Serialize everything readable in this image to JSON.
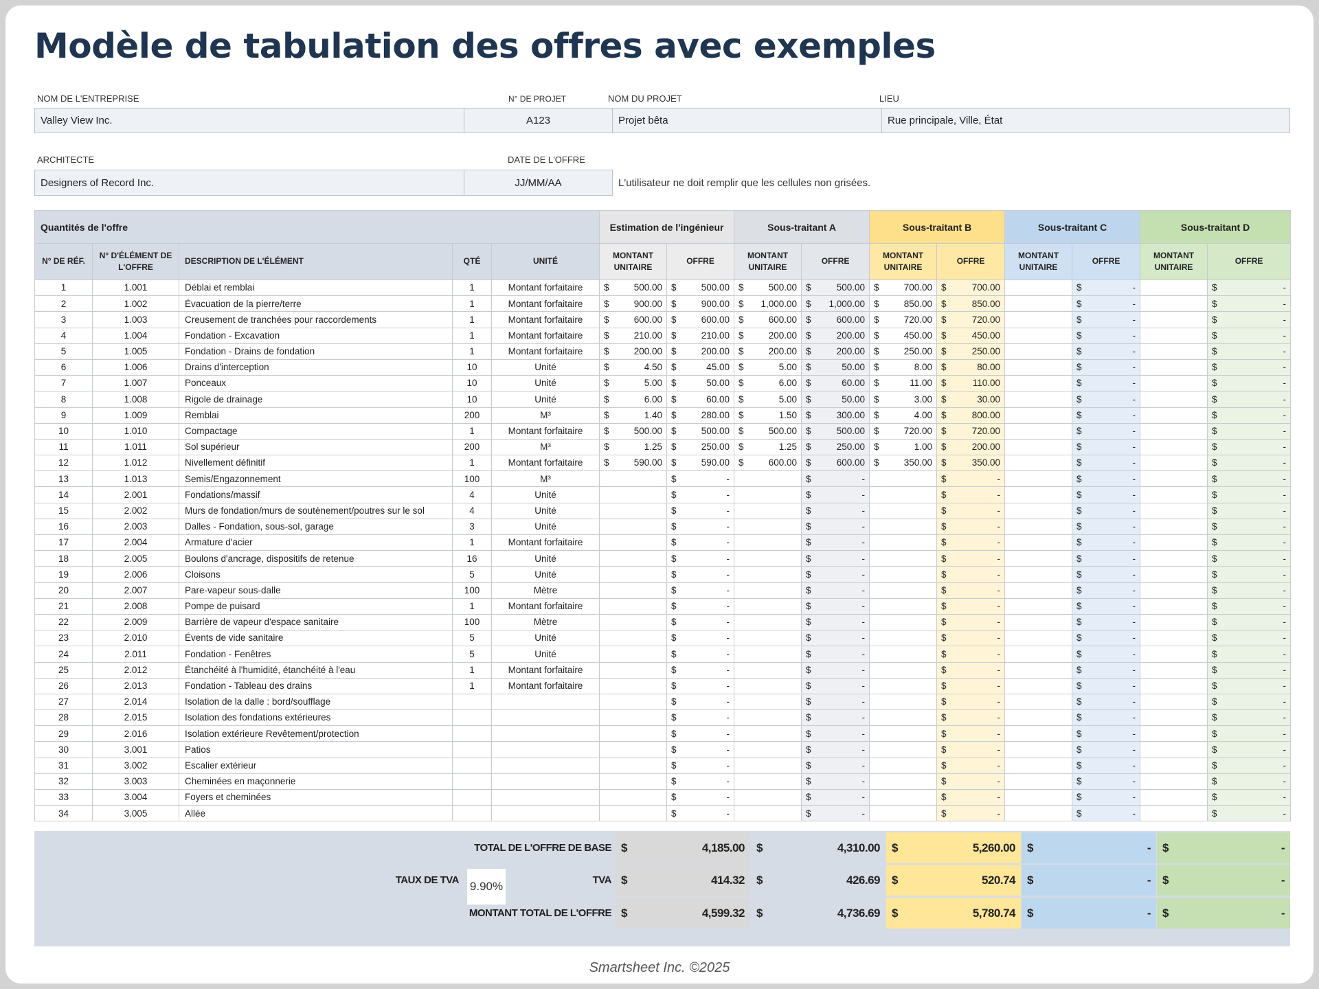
{
  "title": "Modèle de tabulation des offres avec exemples",
  "info": {
    "company_label": "NOM DE L'ENTREPRISE",
    "company_value": "Valley View Inc.",
    "project_no_label": "N° DE PROJET",
    "project_no_value": "A123",
    "project_name_label": "NOM DU PROJET",
    "project_name_value": "Projet bêta",
    "location_label": "LIEU",
    "location_value": "Rue principale, Ville, État",
    "architect_label": "ARCHITECTE",
    "architect_value": "Designers of Record Inc.",
    "date_label": "DATE DE L'OFFRE",
    "date_value": "JJ/MM/AA",
    "note": "L'utilisateur ne doit remplir que les cellules non grisées."
  },
  "table": {
    "group_header": "Quantités de l'offre",
    "vendor_headers": [
      "Estimation de l'ingénieur",
      "Sous-traitant A",
      "Sous-traitant B",
      "Sous-traitant C",
      "Sous-traitant D"
    ],
    "col_headers": {
      "ref": "N° DE RÉF.",
      "item_no": "N° D'ÉLÉMENT DE L'OFFRE",
      "desc": "DESCRIPTION DE L'ÉLÉMENT",
      "qty": "QTÉ",
      "unit": "UNITÉ",
      "unit_price": "MONTANT UNITAIRE",
      "bid": "OFFRE"
    },
    "currency": "$",
    "dash": "-",
    "rows": [
      {
        "ref": "1",
        "item": "1.001",
        "desc": "Déblai et remblai",
        "qty": "1",
        "unit": "Montant forfaitaire",
        "eu": "500.00",
        "eo": "500.00",
        "au": "500.00",
        "ao": "500.00",
        "bu": "700.00",
        "bo": "700.00"
      },
      {
        "ref": "2",
        "item": "1.002",
        "desc": "Évacuation de la pierre/terre",
        "qty": "1",
        "unit": "Montant forfaitaire",
        "eu": "900.00",
        "eo": "900.00",
        "au": "1,000.00",
        "ao": "1,000.00",
        "bu": "850.00",
        "bo": "850.00"
      },
      {
        "ref": "3",
        "item": "1.003",
        "desc": "Creusement de tranchées pour raccordements",
        "qty": "1",
        "unit": "Montant forfaitaire",
        "eu": "600.00",
        "eo": "600.00",
        "au": "600.00",
        "ao": "600.00",
        "bu": "720.00",
        "bo": "720.00"
      },
      {
        "ref": "4",
        "item": "1.004",
        "desc": "Fondation - Excavation",
        "qty": "1",
        "unit": "Montant forfaitaire",
        "eu": "210.00",
        "eo": "210.00",
        "au": "200.00",
        "ao": "200.00",
        "bu": "450.00",
        "bo": "450.00"
      },
      {
        "ref": "5",
        "item": "1.005",
        "desc": "Fondation - Drains de fondation",
        "qty": "1",
        "unit": "Montant forfaitaire",
        "eu": "200.00",
        "eo": "200.00",
        "au": "200.00",
        "ao": "200.00",
        "bu": "250.00",
        "bo": "250.00"
      },
      {
        "ref": "6",
        "item": "1.006",
        "desc": "Drains d'interception",
        "qty": "10",
        "unit": "Unité",
        "eu": "4.50",
        "eo": "45.00",
        "au": "5.00",
        "ao": "50.00",
        "bu": "8.00",
        "bo": "80.00"
      },
      {
        "ref": "7",
        "item": "1.007",
        "desc": "Ponceaux",
        "qty": "10",
        "unit": "Unité",
        "eu": "5.00",
        "eo": "50.00",
        "au": "6.00",
        "ao": "60.00",
        "bu": "11.00",
        "bo": "110.00"
      },
      {
        "ref": "8",
        "item": "1.008",
        "desc": "Rigole de drainage",
        "qty": "10",
        "unit": "Unité",
        "eu": "6.00",
        "eo": "60.00",
        "au": "5.00",
        "ao": "50.00",
        "bu": "3.00",
        "bo": "30.00"
      },
      {
        "ref": "9",
        "item": "1.009",
        "desc": "Remblai",
        "qty": "200",
        "unit": "M³",
        "eu": "1.40",
        "eo": "280.00",
        "au": "1.50",
        "ao": "300.00",
        "bu": "4.00",
        "bo": "800.00"
      },
      {
        "ref": "10",
        "item": "1.010",
        "desc": "Compactage",
        "qty": "1",
        "unit": "Montant forfaitaire",
        "eu": "500.00",
        "eo": "500.00",
        "au": "500.00",
        "ao": "500.00",
        "bu": "720.00",
        "bo": "720.00"
      },
      {
        "ref": "11",
        "item": "1.011",
        "desc": "Sol supérieur",
        "qty": "200",
        "unit": "M³",
        "eu": "1.25",
        "eo": "250.00",
        "au": "1.25",
        "ao": "250.00",
        "bu": "1.00",
        "bo": "200.00"
      },
      {
        "ref": "12",
        "item": "1.012",
        "desc": "Nivellement définitif",
        "qty": "1",
        "unit": "Montant forfaitaire",
        "eu": "590.00",
        "eo": "590.00",
        "au": "600.00",
        "ao": "600.00",
        "bu": "350.00",
        "bo": "350.00"
      },
      {
        "ref": "13",
        "item": "1.013",
        "desc": "Semis/Engazonnement",
        "qty": "100",
        "unit": "M³"
      },
      {
        "ref": "14",
        "item": "2.001",
        "desc": "Fondations/massif",
        "qty": "4",
        "unit": "Unité"
      },
      {
        "ref": "15",
        "item": "2.002",
        "desc": "Murs de fondation/murs de soutènement/poutres sur le sol",
        "qty": "4",
        "unit": "Unité"
      },
      {
        "ref": "16",
        "item": "2.003",
        "desc": "Dalles - Fondation, sous-sol, garage",
        "qty": "3",
        "unit": "Unité"
      },
      {
        "ref": "17",
        "item": "2.004",
        "desc": "Armature d'acier",
        "qty": "1",
        "unit": "Montant forfaitaire"
      },
      {
        "ref": "18",
        "item": "2.005",
        "desc": "Boulons d'ancrage, dispositifs de retenue",
        "qty": "16",
        "unit": "Unité"
      },
      {
        "ref": "19",
        "item": "2.006",
        "desc": "Cloisons",
        "qty": "5",
        "unit": "Unité"
      },
      {
        "ref": "20",
        "item": "2.007",
        "desc": "Pare-vapeur sous-dalle",
        "qty": "100",
        "unit": "Mètre"
      },
      {
        "ref": "21",
        "item": "2.008",
        "desc": "Pompe de puisard",
        "qty": "1",
        "unit": "Montant forfaitaire"
      },
      {
        "ref": "22",
        "item": "2.009",
        "desc": "Barrière de vapeur d'espace sanitaire",
        "qty": "100",
        "unit": "Mètre"
      },
      {
        "ref": "23",
        "item": "2.010",
        "desc": "Évents de vide sanitaire",
        "qty": "5",
        "unit": "Unité"
      },
      {
        "ref": "24",
        "item": "2.011",
        "desc": "Fondation - Fenêtres",
        "qty": "5",
        "unit": "Unité"
      },
      {
        "ref": "25",
        "item": "2.012",
        "desc": "Étanchéité à l'humidité, étanchéité à l'eau",
        "qty": "1",
        "unit": "Montant forfaitaire"
      },
      {
        "ref": "26",
        "item": "2.013",
        "desc": "Fondation - Tableau des drains",
        "qty": "1",
        "unit": "Montant forfaitaire"
      },
      {
        "ref": "27",
        "item": "2.014",
        "desc": "Isolation de la dalle : bord/soufflage",
        "qty": "",
        "unit": ""
      },
      {
        "ref": "28",
        "item": "2.015",
        "desc": "Isolation des fondations extérieures",
        "qty": "",
        "unit": ""
      },
      {
        "ref": "29",
        "item": "2.016",
        "desc": "Isolation extérieure Revêtement/protection",
        "qty": "",
        "unit": ""
      },
      {
        "ref": "30",
        "item": "3.001",
        "desc": "Patios",
        "qty": "",
        "unit": ""
      },
      {
        "ref": "31",
        "item": "3.002",
        "desc": "Escalier extérieur",
        "qty": "",
        "unit": ""
      },
      {
        "ref": "32",
        "item": "3.003",
        "desc": "Cheminées en maçonnerie",
        "qty": "",
        "unit": ""
      },
      {
        "ref": "33",
        "item": "3.004",
        "desc": "Foyers et cheminées",
        "qty": "",
        "unit": ""
      },
      {
        "ref": "34",
        "item": "3.005",
        "desc": "Allée",
        "qty": "",
        "unit": ""
      }
    ]
  },
  "totals": {
    "base_label": "TOTAL DE L'OFFRE DE BASE",
    "vat_rate_label": "TAUX DE TVA",
    "vat_rate_value": "9.90%",
    "vat_label": "TVA",
    "grand_label": "MONTANT TOTAL DE L'OFFRE",
    "base": [
      "4,185.00",
      "4,310.00",
      "5,260.00",
      "-",
      "-"
    ],
    "vat": [
      "414.32",
      "426.69",
      "520.74",
      "-",
      "-"
    ],
    "grand": [
      "4,599.32",
      "4,736.69",
      "5,780.74",
      "-",
      "-"
    ],
    "colors": [
      "#d9d9d9",
      "#d6dce5",
      "#ffe699",
      "#bdd7ee",
      "#c6e0b4"
    ]
  },
  "footer": "Smartsheet Inc. ©2025"
}
